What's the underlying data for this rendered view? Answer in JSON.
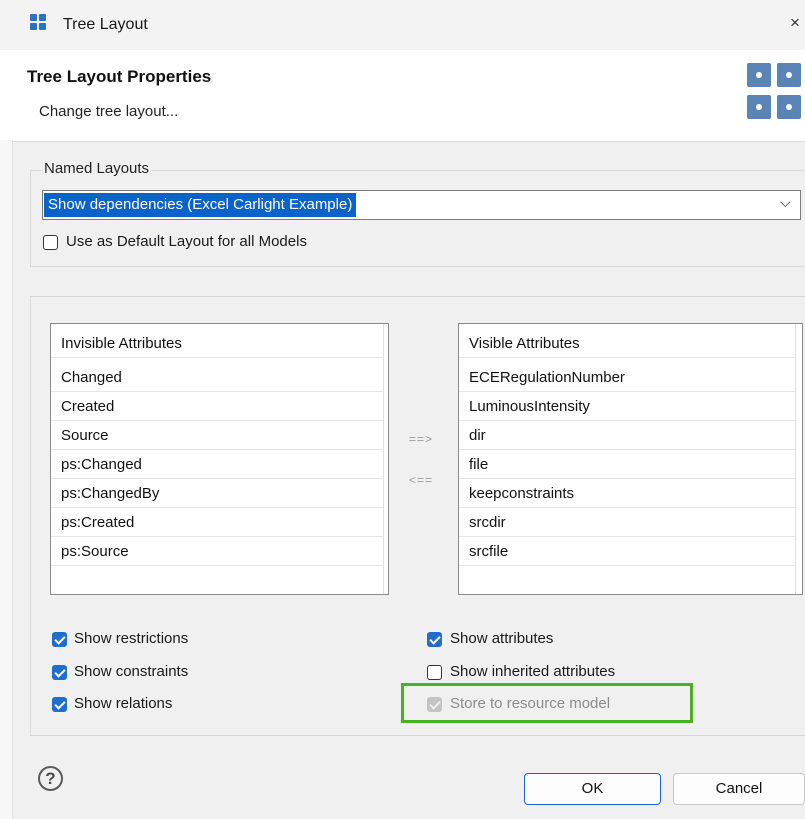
{
  "window": {
    "title": "Tree Layout",
    "close_glyph": "×"
  },
  "header": {
    "title": "Tree Layout Properties",
    "subtitle": "Change tree layout..."
  },
  "named_layouts": {
    "legend": "Named Layouts",
    "selected": "Show dependencies (Excel Carlight Example)",
    "default_checkbox_label": "Use as Default Layout for all Models",
    "default_checked": false
  },
  "attributes": {
    "invisible_header": "Invisible Attributes",
    "invisible": [
      "Changed",
      "Created",
      "Source",
      "ps:Changed",
      "ps:ChangedBy",
      "ps:Created",
      "ps:Source"
    ],
    "visible_header": "Visible Attributes",
    "visible": [
      "ECERegulationNumber",
      "LuminousIntensity",
      "dir",
      "file",
      "keepconstraints",
      "srcdir",
      "srcfile"
    ],
    "move_right_label": "==>",
    "move_left_label": "<=="
  },
  "options": {
    "show_restrictions": {
      "label": "Show restrictions",
      "checked": true
    },
    "show_constraints": {
      "label": "Show constraints",
      "checked": true
    },
    "show_relations": {
      "label": "Show relations",
      "checked": true
    },
    "show_attributes": {
      "label": "Show attributes",
      "checked": true
    },
    "show_inherited_attributes": {
      "label": "Show inherited attributes",
      "checked": false
    },
    "store_to_resource_model": {
      "label": "Store to resource model",
      "checked": true,
      "disabled": true
    }
  },
  "footer": {
    "help_glyph": "?",
    "ok_label": "OK",
    "cancel_label": "Cancel"
  },
  "colors": {
    "accent": "#1f6fc9",
    "selection": "#0b63c9",
    "highlight_box": "#4caf28",
    "banner_icon": "#5884b6"
  },
  "icons": {
    "app": "tree-layout-grid-icon",
    "banner": "tree-layout-grid-icon"
  }
}
